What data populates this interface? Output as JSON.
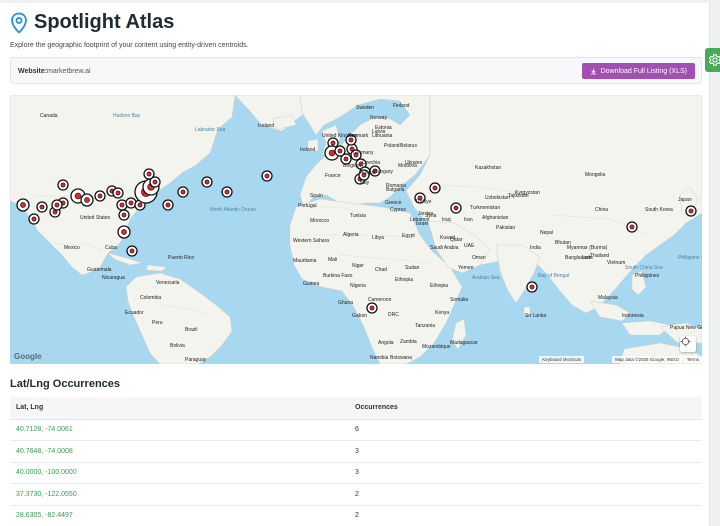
{
  "page": {
    "title": "Spotlight Atlas",
    "subtitle": "Explore the geographic footprint of your content using entity-driven centroids."
  },
  "website": {
    "label": "Website:",
    "value": "marketbrew.ai",
    "download_label": "Download Full Listing (XLS)"
  },
  "map": {
    "google": "Google",
    "keyboard_shortcuts": "Keyboard shortcuts",
    "map_data": "Map data ©2025 Google, INEGI",
    "terms": "Terms",
    "labels": [
      {
        "text": "Canada"
      },
      {
        "text": "Hudson Bay"
      },
      {
        "text": "Labrador Sea"
      },
      {
        "text": "Iceland"
      },
      {
        "text": "Finland"
      },
      {
        "text": "Sweden"
      },
      {
        "text": "United Kingdom"
      },
      {
        "text": "Denmark"
      },
      {
        "text": "Ireland"
      },
      {
        "text": "Poland"
      },
      {
        "text": "Belarus"
      },
      {
        "text": "Germany"
      },
      {
        "text": "Ukraine"
      },
      {
        "text": "France"
      },
      {
        "text": "Kazakhstan"
      },
      {
        "text": "Mongolia"
      },
      {
        "text": "Kyrgyzstan"
      },
      {
        "text": "Spain"
      },
      {
        "text": "Portugal"
      },
      {
        "text": "Greece"
      },
      {
        "text": "Türkiye"
      },
      {
        "text": "Syria"
      },
      {
        "text": "Iraq"
      },
      {
        "text": "Iran"
      },
      {
        "text": "Afghanistan"
      },
      {
        "text": "Pakistan"
      },
      {
        "text": "China"
      },
      {
        "text": "South Korea"
      },
      {
        "text": "Japan"
      },
      {
        "text": "Nepal"
      },
      {
        "text": "India"
      },
      {
        "text": "Myanmar (Burma)"
      },
      {
        "text": "Thailand"
      },
      {
        "text": "Vietnam"
      },
      {
        "text": "Philippines"
      },
      {
        "text": "Malaysia"
      },
      {
        "text": "Indonesia"
      },
      {
        "text": "Papua New Guinea"
      },
      {
        "text": "Morocco"
      },
      {
        "text": "Tunisia"
      },
      {
        "text": "Algeria"
      },
      {
        "text": "Libya"
      },
      {
        "text": "Egypt"
      },
      {
        "text": "Western Sahara"
      },
      {
        "text": "Mauritania"
      },
      {
        "text": "Mali"
      },
      {
        "text": "Niger"
      },
      {
        "text": "Chad"
      },
      {
        "text": "Sudan"
      },
      {
        "text": "Saudi Arabia"
      },
      {
        "text": "Oman"
      },
      {
        "text": "Yemen"
      },
      {
        "text": "Burkina Faso"
      },
      {
        "text": "Guinea"
      },
      {
        "text": "Nigeria"
      },
      {
        "text": "Ethiopia"
      },
      {
        "text": "Somalia"
      },
      {
        "text": "Kenya"
      },
      {
        "text": "Gabon"
      },
      {
        "text": "DRC"
      },
      {
        "text": "Tanzania"
      },
      {
        "text": "Angola"
      },
      {
        "text": "Zambia"
      },
      {
        "text": "Mozambique"
      },
      {
        "text": "Namibia"
      },
      {
        "text": "Botswana"
      },
      {
        "text": "Madagascar"
      },
      {
        "text": "United States"
      },
      {
        "text": "Mexico"
      },
      {
        "text": "Cuba"
      },
      {
        "text": "Guatemala"
      },
      {
        "text": "Nicaragua"
      },
      {
        "text": "Puerto Rico"
      },
      {
        "text": "Venezuela"
      },
      {
        "text": "Colombia"
      },
      {
        "text": "Ecuador"
      },
      {
        "text": "Peru"
      },
      {
        "text": "Brazil"
      },
      {
        "text": "Bolivia"
      },
      {
        "text": "Paraguay"
      },
      {
        "text": "North Atlantic Ocean"
      },
      {
        "text": "Arabian Sea"
      },
      {
        "text": "Bay of Bengal"
      },
      {
        "text": "Philippine Sea"
      },
      {
        "text": "South China Sea"
      },
      {
        "text": "Ethiopia"
      },
      {
        "text": "Sri Lanka"
      },
      {
        "text": "Bangladesh"
      },
      {
        "text": "Laos"
      },
      {
        "text": "Cameroon"
      },
      {
        "text": "Ghana"
      },
      {
        "text": "Uzbekistan"
      },
      {
        "text": "Turkmenistan"
      },
      {
        "text": "Norway"
      },
      {
        "text": "Romania"
      },
      {
        "text": "Italy"
      },
      {
        "text": "Lithuania"
      },
      {
        "text": "Estonia"
      },
      {
        "text": "Latvia"
      },
      {
        "text": "Belgium"
      },
      {
        "text": "Czechia"
      },
      {
        "text": "Austria"
      },
      {
        "text": "Hungary"
      },
      {
        "text": "Bulgaria"
      },
      {
        "text": "Moldova"
      },
      {
        "text": "Kuwait"
      },
      {
        "text": "Qatar"
      },
      {
        "text": "UAE"
      },
      {
        "text": "Jordan"
      },
      {
        "text": "Israel"
      },
      {
        "text": "Lebanon"
      },
      {
        "text": "Cyprus"
      },
      {
        "text": "Tajikistan"
      },
      {
        "text": "Bhutan"
      }
    ]
  },
  "table": {
    "title": "Lat/Lng Occurrences",
    "headers": [
      "Lat, Lng",
      "Occurrences"
    ],
    "rows": [
      {
        "latlng": "40.7128, -74.0061",
        "count": "6"
      },
      {
        "latlng": "40.7648, -74.0008",
        "count": "3"
      },
      {
        "latlng": "40.0000, -100.0000",
        "count": "3"
      },
      {
        "latlng": "37.3730, -122.0550",
        "count": "2"
      },
      {
        "latlng": "28.6305, -82.4497",
        "count": "2"
      }
    ]
  },
  "colors": {
    "accent": "#a24fb3",
    "link": "#3c9a55",
    "settings": "#4aa85a",
    "land": "#f5f5f2",
    "water": "#a7d8f0"
  }
}
